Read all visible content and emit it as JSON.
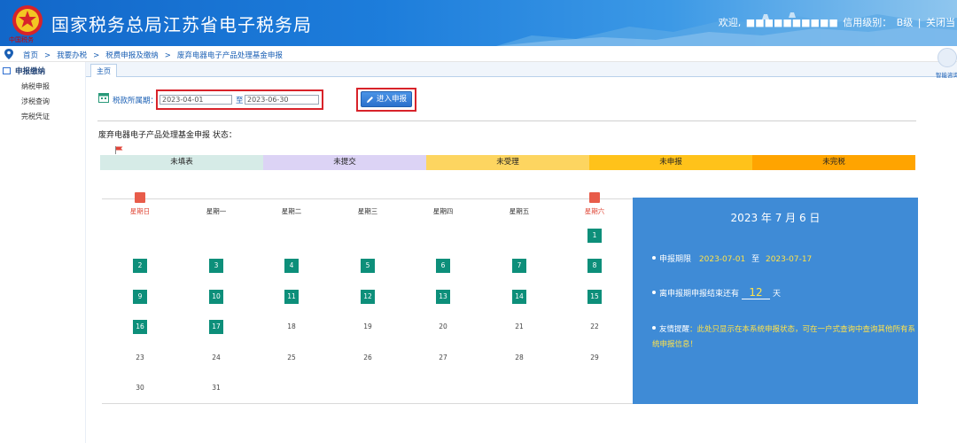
{
  "header": {
    "title": "国家税务总局江苏省电子税务局",
    "emblem_text": "中国税务",
    "welcome": "欢迎,",
    "user_masked": "■■■■■■■■■■",
    "credit_label": "信用级别：",
    "credit_value": "B级",
    "divider": "|",
    "close_label": "关闭当"
  },
  "helper": {
    "label": "智能咨询"
  },
  "breadcrumb": {
    "items": [
      "首页",
      "我要办税",
      "税费申报及缴纳",
      "废弃电器电子产品处理基金申报"
    ],
    "separator": ">"
  },
  "sidebar": {
    "title": "申报缴纳",
    "items": [
      "纳税申报",
      "涉税查询",
      "完税凭证"
    ]
  },
  "tabs": [
    {
      "label": "主页"
    }
  ],
  "period": {
    "label": "税款所属期：",
    "start": "2023-04-01",
    "to": "至",
    "end": "2023-06-30"
  },
  "enter_button": {
    "label": "进入申报"
  },
  "status": {
    "title": "废弃电器电子产品处理基金申报 状态：",
    "segments": [
      {
        "label": "未填表",
        "color": "#d6ebe7"
      },
      {
        "label": "未提交",
        "color": "#dcd3f5"
      },
      {
        "label": "未受理",
        "color": "#fdd560"
      },
      {
        "label": "未申报",
        "color": "#ffc21a"
      },
      {
        "label": "未完税",
        "color": "#ffa400"
      }
    ]
  },
  "calendar": {
    "weekdays": [
      "星期日",
      "星期一",
      "星期二",
      "星期三",
      "星期四",
      "星期五",
      "星期六"
    ],
    "days": [
      {
        "d": "1",
        "col": 6,
        "row": 0,
        "filled": true
      },
      {
        "d": "2",
        "col": 0,
        "row": 1,
        "filled": true
      },
      {
        "d": "3",
        "col": 1,
        "row": 1,
        "filled": true
      },
      {
        "d": "4",
        "col": 2,
        "row": 1,
        "filled": true
      },
      {
        "d": "5",
        "col": 3,
        "row": 1,
        "filled": true
      },
      {
        "d": "6",
        "col": 4,
        "row": 1,
        "filled": true
      },
      {
        "d": "7",
        "col": 5,
        "row": 1,
        "filled": true
      },
      {
        "d": "8",
        "col": 6,
        "row": 1,
        "filled": true
      },
      {
        "d": "9",
        "col": 0,
        "row": 2,
        "filled": true
      },
      {
        "d": "10",
        "col": 1,
        "row": 2,
        "filled": true
      },
      {
        "d": "11",
        "col": 2,
        "row": 2,
        "filled": true
      },
      {
        "d": "12",
        "col": 3,
        "row": 2,
        "filled": true
      },
      {
        "d": "13",
        "col": 4,
        "row": 2,
        "filled": true
      },
      {
        "d": "14",
        "col": 5,
        "row": 2,
        "filled": true
      },
      {
        "d": "15",
        "col": 6,
        "row": 2,
        "filled": true
      },
      {
        "d": "16",
        "col": 0,
        "row": 3,
        "filled": true
      },
      {
        "d": "17",
        "col": 1,
        "row": 3,
        "filled": true
      },
      {
        "d": "18",
        "col": 2,
        "row": 3,
        "filled": false
      },
      {
        "d": "19",
        "col": 3,
        "row": 3,
        "filled": false
      },
      {
        "d": "20",
        "col": 4,
        "row": 3,
        "filled": false
      },
      {
        "d": "21",
        "col": 5,
        "row": 3,
        "filled": false
      },
      {
        "d": "22",
        "col": 6,
        "row": 3,
        "filled": false
      },
      {
        "d": "23",
        "col": 0,
        "row": 4,
        "filled": false
      },
      {
        "d": "24",
        "col": 1,
        "row": 4,
        "filled": false
      },
      {
        "d": "25",
        "col": 2,
        "row": 4,
        "filled": false
      },
      {
        "d": "26",
        "col": 3,
        "row": 4,
        "filled": false
      },
      {
        "d": "27",
        "col": 4,
        "row": 4,
        "filled": false
      },
      {
        "d": "28",
        "col": 5,
        "row": 4,
        "filled": false
      },
      {
        "d": "29",
        "col": 6,
        "row": 4,
        "filled": false
      },
      {
        "d": "30",
        "col": 0,
        "row": 5,
        "filled": false
      },
      {
        "d": "31",
        "col": 1,
        "row": 5,
        "filled": false
      }
    ]
  },
  "info": {
    "date": "2023 年 7 月 6 日",
    "deadline_label": "申报期限",
    "deadline_start": "2023-07-01",
    "deadline_to": "至",
    "deadline_end": "2023-07-17",
    "remaining_prefix": "离申报期申报结束还有",
    "remaining_days": "12",
    "remaining_suffix": "天",
    "reminder_label": "友情提醒",
    "reminder_text": "：此处只显示在本系统申报状态，可在一户式查询中查询其他所有系统申报信息！"
  }
}
